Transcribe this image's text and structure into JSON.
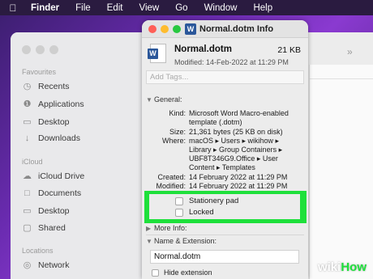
{
  "menubar": {
    "app": "Finder",
    "items": [
      "File",
      "Edit",
      "View",
      "Go",
      "Window",
      "Help"
    ]
  },
  "finder_sidebar": {
    "favourites_title": "Favourites",
    "favourites": [
      {
        "label": "Recents",
        "icon": "clock-icon"
      },
      {
        "label": "Applications",
        "icon": "applications-icon"
      },
      {
        "label": "Desktop",
        "icon": "desktop-icon"
      },
      {
        "label": "Downloads",
        "icon": "downloads-icon"
      }
    ],
    "icloud_title": "iCloud",
    "icloud": [
      {
        "label": "iCloud Drive",
        "icon": "cloud-icon"
      },
      {
        "label": "Documents",
        "icon": "document-icon"
      },
      {
        "label": "Desktop",
        "icon": "desktop-icon"
      },
      {
        "label": "Shared",
        "icon": "shared-folder-icon"
      }
    ],
    "locations_title": "Locations",
    "locations": [
      {
        "label": "Network",
        "icon": "network-icon"
      }
    ]
  },
  "info": {
    "window_title": "Normal.dotm Info",
    "file_name": "Normal.dotm",
    "file_size": "21 KB",
    "modified": "Modified: 14-Feb-2022 at 11:29 PM",
    "tags_placeholder": "Add Tags...",
    "general_title": "General:",
    "general": {
      "kind_key": "Kind:",
      "kind_lines": [
        "Microsoft Word Macro-enabled",
        "template (.dotm)"
      ],
      "size_key": "Size:",
      "size_val": "21,361 bytes (25 KB on disk)",
      "where_key": "Where:",
      "where_lines": [
        "macOS ▸ Users ▸ wikihow ▸",
        "Library ▸ Group Containers ▸",
        "UBF8T346G9.Office ▸ User",
        "Content ▸ Templates"
      ],
      "created_key": "Created:",
      "created_val": "14 February 2022 at 11:29 PM",
      "modified_key": "Modified:",
      "modified_val": "14 February 2022 at 11:29 PM"
    },
    "stationery_label": "Stationery pad",
    "locked_label": "Locked",
    "more_info_title": "More Info:",
    "name_ext_title": "Name & Extension:",
    "name_value": "Normal.dotm",
    "hide_extension_label": "Hide extension"
  },
  "highlight_color": "#1ee03b",
  "watermark": {
    "wiki": "wiki",
    "how": "How"
  }
}
